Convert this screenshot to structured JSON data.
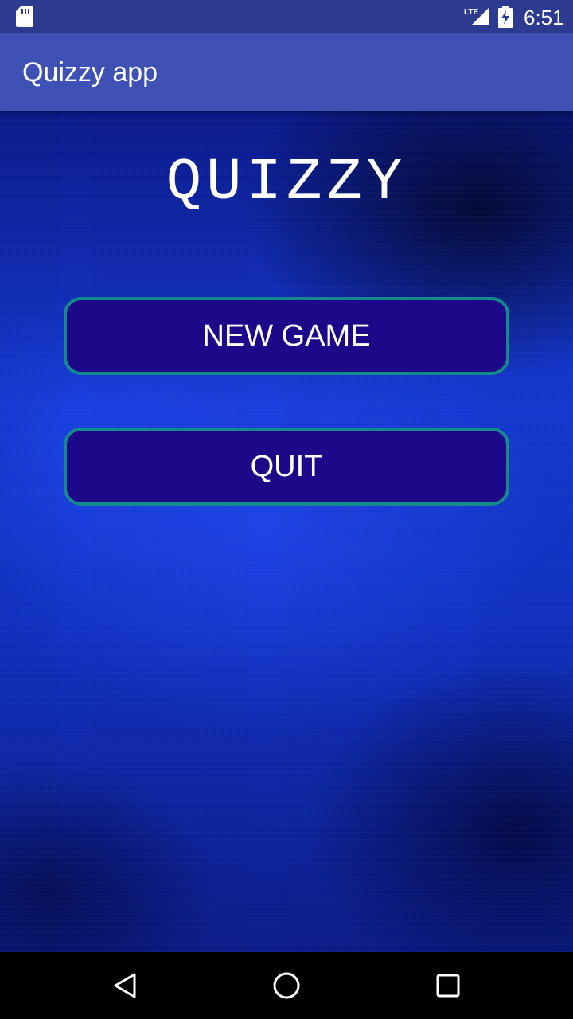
{
  "status_bar": {
    "time": "6:51",
    "network": "LTE",
    "icons": [
      "sd-card-icon",
      "lte-signal-icon",
      "battery-charging-icon"
    ]
  },
  "app_bar": {
    "title": "Quizzy app"
  },
  "main": {
    "heading": "QUIZZY",
    "buttons": {
      "new_game": "NEW GAME",
      "quit": "QUIT"
    }
  },
  "nav_bar": {
    "icons": [
      "back-icon",
      "home-icon",
      "recents-icon"
    ]
  },
  "colors": {
    "status_bar": "#2c3a8f",
    "app_bar": "#3f51b5",
    "button_fill": "#1d088a",
    "button_border": "#148a8c",
    "background": "#1030c0"
  }
}
